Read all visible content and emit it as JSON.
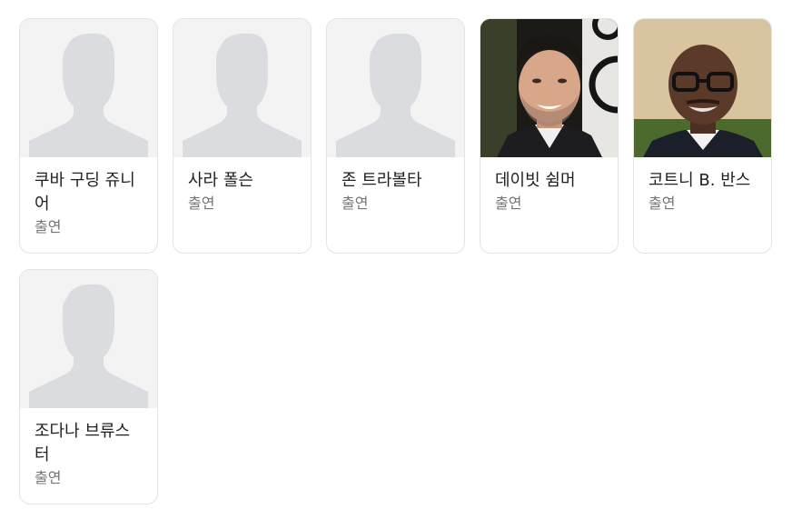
{
  "cast": [
    {
      "name": "쿠바 구딩 쥬니어",
      "role": "출연",
      "photo": "placeholder-silhouette"
    },
    {
      "name": "사라 폴슨",
      "role": "출연",
      "photo": "placeholder-silhouette"
    },
    {
      "name": "존 트라볼타",
      "role": "출연",
      "photo": "placeholder-silhouette"
    },
    {
      "name": "데이빗 쉼머",
      "role": "출연",
      "photo": "portrait"
    },
    {
      "name": "코트니 B. 반스",
      "role": "출연",
      "photo": "portrait"
    },
    {
      "name": "조다나 브류스터",
      "role": "출연",
      "photo": "placeholder-silhouette"
    }
  ],
  "colors": {
    "placeholder_bg": "#f3f3f4",
    "silhouette": "#dadce0",
    "name_text": "#202124",
    "role_text": "#70757a",
    "card_border": "#e3e3e3"
  }
}
